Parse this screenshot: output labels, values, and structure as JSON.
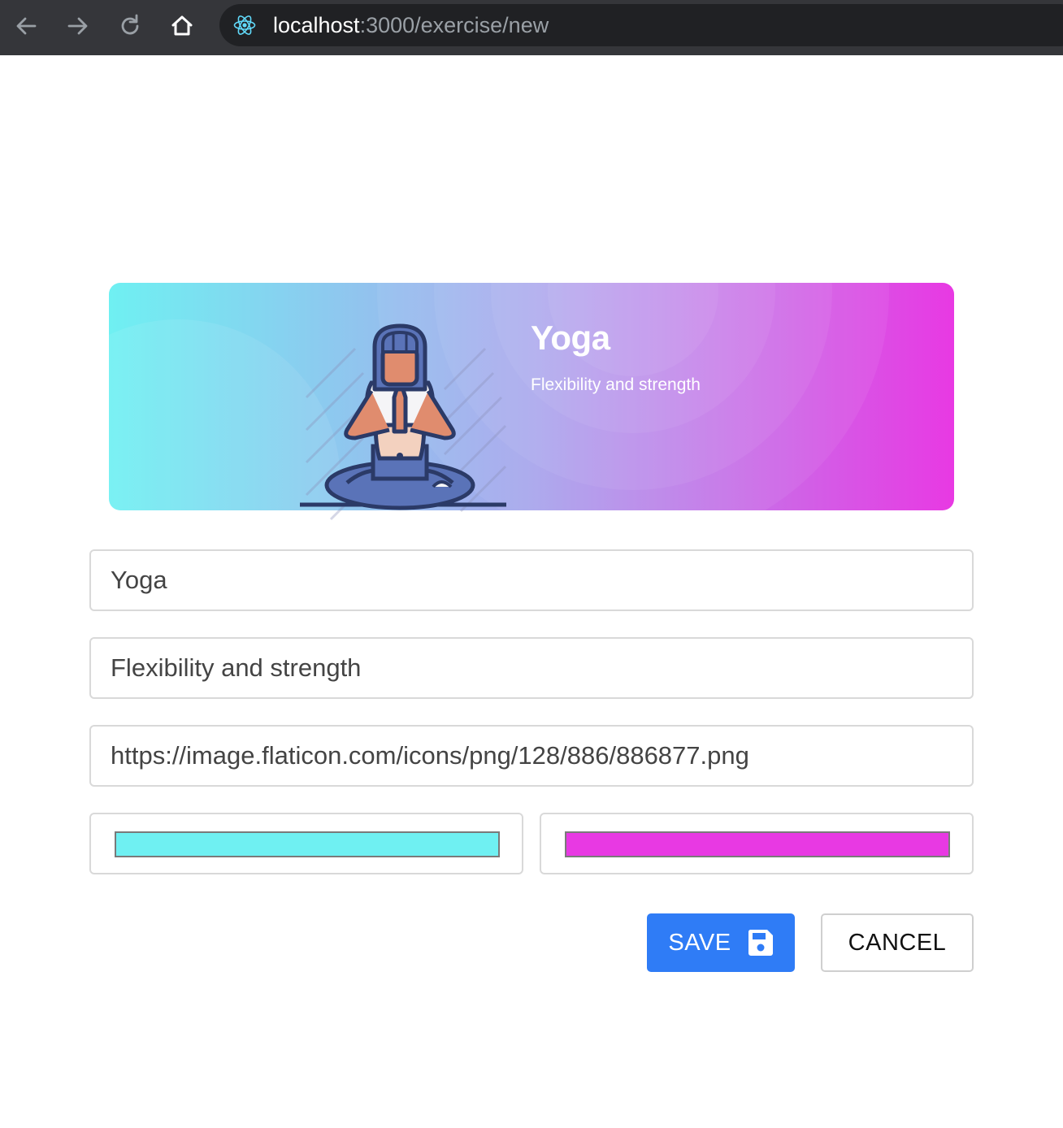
{
  "browser": {
    "url_host": "localhost",
    "url_path": ":3000/exercise/new",
    "site_icon": "react-atom-icon"
  },
  "banner": {
    "title": "Yoga",
    "description": "Flexibility and strength",
    "image_name": "yoga-meditation-icon",
    "left_color": "#6FF0F2",
    "right_color": "#E839E3"
  },
  "form": {
    "title_value": "Yoga",
    "description_value": "Flexibility and strength",
    "image_value": "https://image.flaticon.com/icons/png/128/886/886877.png",
    "left_color_value": "#6FF0F2",
    "right_color_value": "#E839E3"
  },
  "actions": {
    "save_label": "SAVE",
    "save_icon": "floppy-disk-icon",
    "cancel_label": "CANCEL"
  }
}
